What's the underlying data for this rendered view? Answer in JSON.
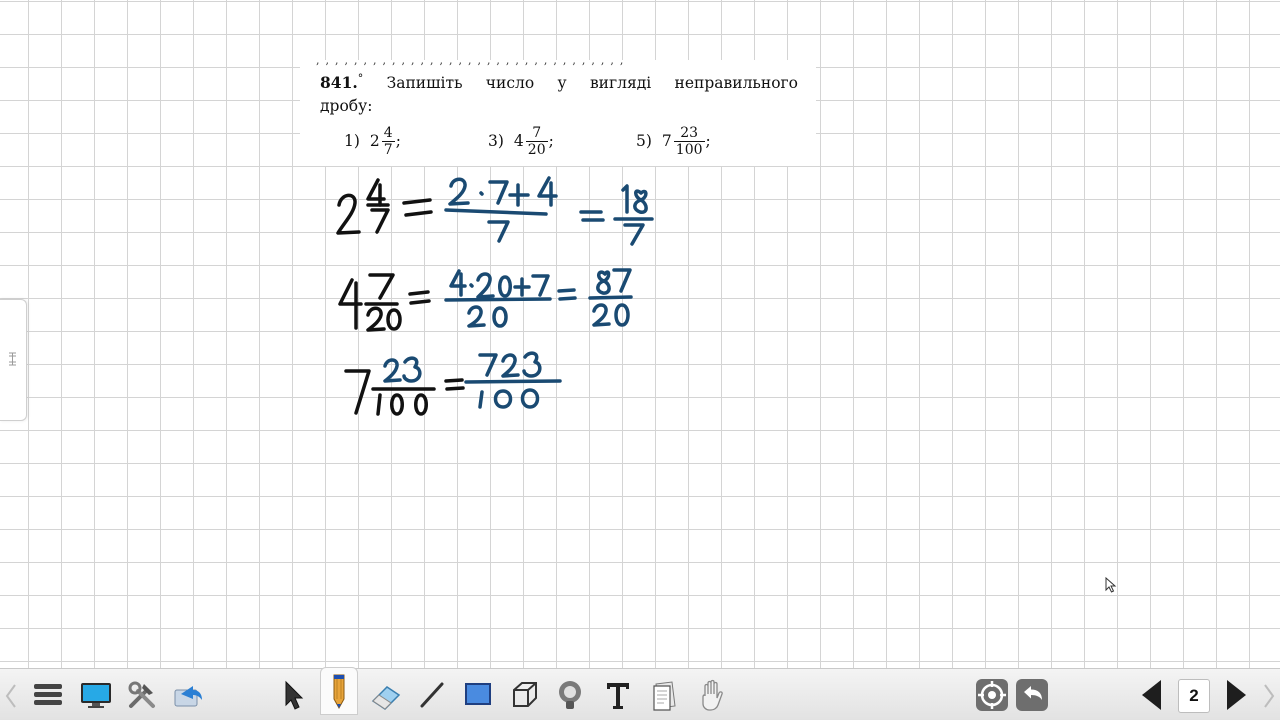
{
  "exercise": {
    "number": "841.",
    "marker": "°",
    "statement_line1": "Запишіть число у вигляді неправильного",
    "statement_line2": "дробу:",
    "items": [
      {
        "index": "1)",
        "whole": "2",
        "numerator": "4",
        "denominator": "7",
        "suffix": ";"
      },
      {
        "index": "3)",
        "whole": "4",
        "numerator": "7",
        "denominator": "20",
        "suffix": ";"
      },
      {
        "index": "5)",
        "whole": "7",
        "numerator": "23",
        "denominator": "100",
        "suffix": ";"
      }
    ]
  },
  "handwriting": {
    "lines": [
      {
        "lhs": "2 4/7",
        "middle": "(2·7 + 4)/7",
        "rhs": "18/7"
      },
      {
        "lhs": "4 7/20",
        "middle": "(4·20 + 7)/20",
        "rhs": "87/20"
      },
      {
        "lhs": "7 23/100",
        "middle": "723/100",
        "rhs": ""
      }
    ],
    "ink_color_black": "#111111",
    "ink_color_blue": "#1a4a72"
  },
  "toolbar": {
    "left_tools": [
      "menu-icon",
      "display-icon",
      "tools-icon",
      "share-icon"
    ],
    "draw_tools": [
      "pointer-icon",
      "pencil-icon",
      "eraser-icon",
      "line-icon",
      "rectangle-icon",
      "cube-icon",
      "spotlight-icon",
      "text-icon",
      "page-icon",
      "hand-icon"
    ],
    "right_tools": [
      "target-icon",
      "undo-icon"
    ],
    "active_tool": "pencil-icon",
    "page_number": "2",
    "accent_color": "#1f4fb0"
  }
}
